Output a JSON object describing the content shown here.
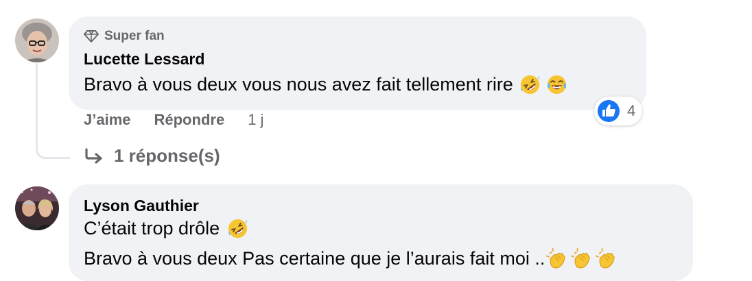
{
  "comments": [
    {
      "badge": "Super fan",
      "author": "Lucette Lessard",
      "lines": [
        "Bravo à vous deux vous nous avez fait tellement rire"
      ],
      "actions": {
        "like": "J’aime",
        "reply": "Répondre",
        "time": "1 j"
      },
      "reaction_count": "4",
      "replies": "1 réponse(s)"
    },
    {
      "author": "Lyson Gauthier",
      "lines": [
        "C’était trop drôle",
        "Bravo à vous deux Pas certaine que je l’aurais fait moi .."
      ]
    }
  ],
  "colors": {
    "bubble": "#f0f2f5",
    "secondary_text": "#65676b",
    "like_blue": "#1877f2",
    "thread_line": "#e4e6eb"
  },
  "icons": {
    "badge": "diamond-icon",
    "reaction": "thumbs-up-icon",
    "replies": "reply-arrow-icon",
    "emoji_laugh": "rolling-on-floor-laughing-emoji",
    "emoji_joy": "tears-of-joy-emoji",
    "emoji_clap": "clapping-hands-emoji"
  }
}
